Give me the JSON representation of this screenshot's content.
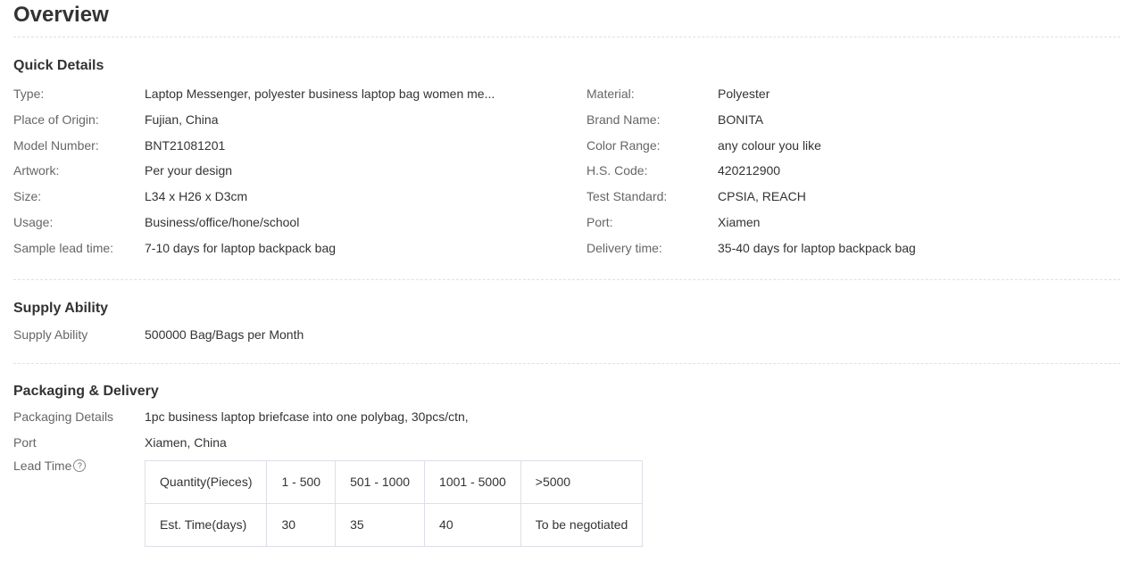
{
  "overview": {
    "title": "Overview"
  },
  "quick_details": {
    "title": "Quick Details",
    "left": [
      {
        "label": "Type:",
        "value": "Laptop Messenger, polyester business laptop bag women me..."
      },
      {
        "label": "Place of Origin:",
        "value": "Fujian, China"
      },
      {
        "label": "Model Number:",
        "value": "BNT21081201"
      },
      {
        "label": "Artwork:",
        "value": "Per your design"
      },
      {
        "label": "Size:",
        "value": "L34 x H26 x D3cm"
      },
      {
        "label": "Usage:",
        "value": "Business/office/hone/school"
      },
      {
        "label": "Sample lead time:",
        "value": "7-10 days for laptop backpack bag"
      }
    ],
    "right": [
      {
        "label": "Material:",
        "value": "Polyester"
      },
      {
        "label": "Brand Name:",
        "value": "BONITA"
      },
      {
        "label": "Color Range:",
        "value": "any colour you like"
      },
      {
        "label": "H.S. Code:",
        "value": "420212900"
      },
      {
        "label": "Test Standard:",
        "value": "CPSIA, REACH"
      },
      {
        "label": "Port:",
        "value": "Xiamen"
      },
      {
        "label": "Delivery time:",
        "value": "35-40 days for laptop backpack bag"
      }
    ]
  },
  "supply_ability": {
    "title": "Supply Ability",
    "label": "Supply Ability",
    "value": "500000 Bag/Bags per Month"
  },
  "packaging": {
    "title": "Packaging & Delivery",
    "rows": [
      {
        "label": "Packaging Details",
        "value": "1pc business laptop briefcase into one polybag, 30pcs/ctn,"
      },
      {
        "label": "Port",
        "value": "Xiamen, China"
      }
    ],
    "lead_time_label": "Lead Time",
    "help_icon": "?",
    "lead_table": [
      [
        "Quantity(Pieces)",
        "1 - 500",
        "501 - 1000",
        "1001 - 5000",
        ">5000"
      ],
      [
        "Est. Time(days)",
        "30",
        "35",
        "40",
        "To be negotiated"
      ]
    ]
  }
}
